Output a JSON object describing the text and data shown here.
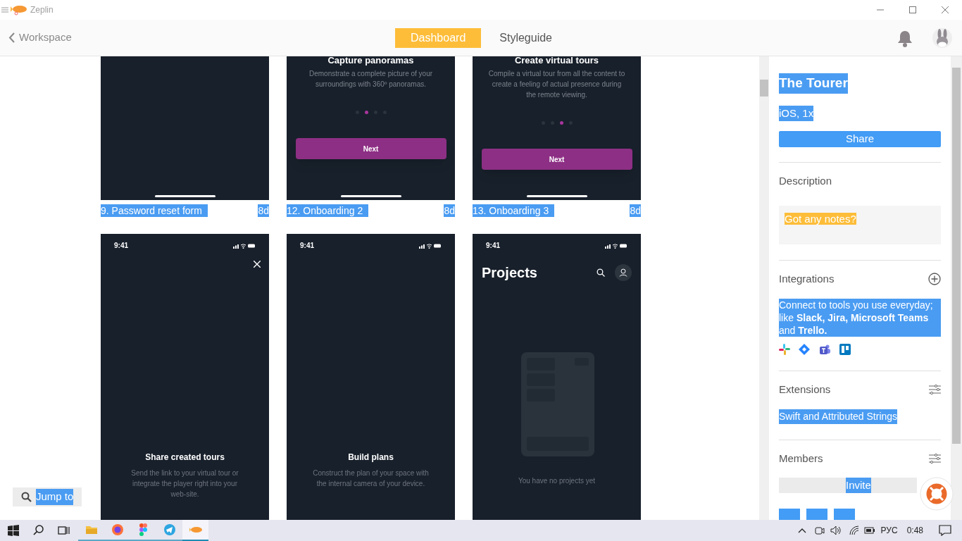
{
  "window": {
    "title": "Zeplin"
  },
  "header": {
    "back": "Workspace",
    "tabs": [
      {
        "label": "Dashboard",
        "selected": true
      },
      {
        "label": "Styleguide",
        "selected": false
      }
    ]
  },
  "artboards": [
    {
      "kind": "blank",
      "name": "9. Password reset form",
      "age": "8d"
    },
    {
      "kind": "onboarding",
      "title": "Capture panoramas",
      "text": "Demonstrate a complete picture of your surroundings with 360º panoramas.",
      "dots": [
        false,
        true,
        false,
        false
      ],
      "button": "Next",
      "name": "12. Onboarding 2",
      "age": "8d"
    },
    {
      "kind": "onboarding",
      "title": "Create virtual tours",
      "text": "Compile a virtual tour from all the content to create a feeling of actual presence during the remote viewing.",
      "dots": [
        false,
        false,
        true,
        false
      ],
      "button": "Next",
      "name": "13. Onboarding 3",
      "age": "8d"
    },
    {
      "kind": "intro",
      "time": "9:41",
      "close": true,
      "title": "Share created tours",
      "text": "Send the link to your virtual tour or integrate the player right into your web-site."
    },
    {
      "kind": "intro",
      "time": "9:41",
      "close": false,
      "title": "Build plans",
      "text": "Construct the plan of your space with the internal camera of your device."
    },
    {
      "kind": "projects",
      "time": "9:41",
      "title": "Projects",
      "text": "You have no projects yet"
    }
  ],
  "jump_to": "Jump to",
  "panel": {
    "project": "The Tourer",
    "platform": "iOS, 1x",
    "share": "Share",
    "description": {
      "title": "Description",
      "placeholder": "Got any notes?"
    },
    "integrations": {
      "title": "Integrations",
      "text": "Connect to tools you use everyday; like **Slack, Jira, Microsoft Teams** and **Trello.**"
    },
    "extensions": {
      "title": "Extensions",
      "item": "Swift and Attributed Strings"
    },
    "members": {
      "title": "Members",
      "invite": "Invite"
    }
  },
  "taskbar": {
    "apps": [
      {
        "kind": "explorer",
        "active": false
      },
      {
        "kind": "firefox",
        "active": false
      },
      {
        "kind": "figma",
        "active": false
      },
      {
        "kind": "telegram",
        "active": false
      },
      {
        "kind": "zeplin",
        "active": true
      }
    ],
    "language": "РУС",
    "time": "0:48"
  }
}
